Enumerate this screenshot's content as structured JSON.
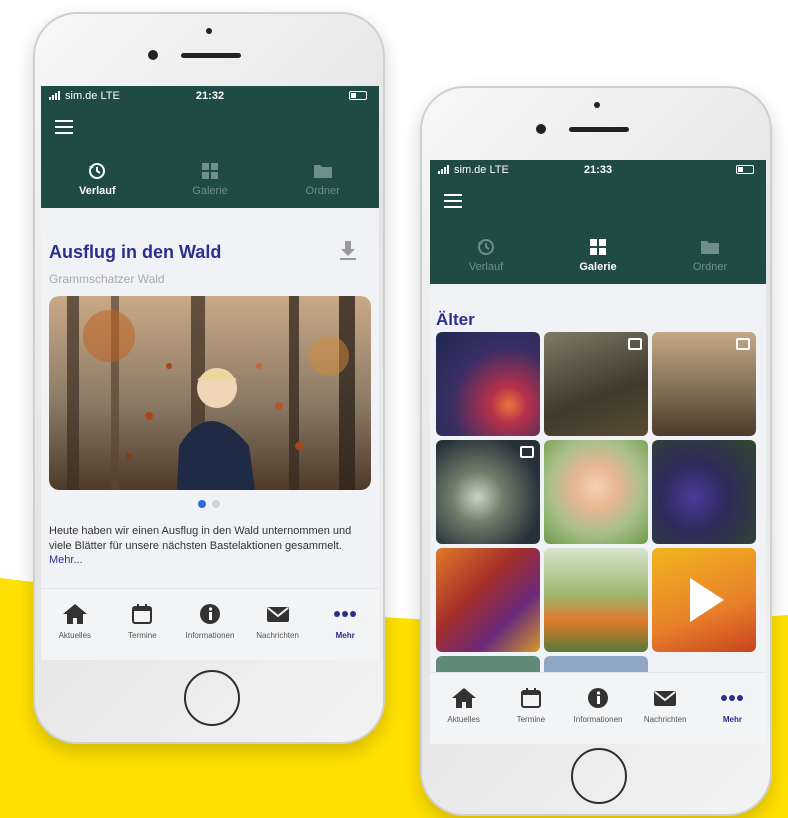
{
  "colors": {
    "accent": "#1f4a46",
    "brand": "#2b2f8e",
    "yellow": "#ffe100"
  },
  "phone1": {
    "status": {
      "carrier": "sim.de  LTE",
      "time": "21:32"
    },
    "tabs": [
      {
        "label": "Verlauf",
        "icon": "history-icon",
        "active": true
      },
      {
        "label": "Galerie",
        "icon": "grid-icon"
      },
      {
        "label": "Ordner",
        "icon": "folder-icon"
      }
    ],
    "post": {
      "title": "Ausflug in den Wald",
      "location": "Grammschatzer Wald",
      "description": "Heute haben wir einen Ausflug in den Wald unternommen und viele Blätter für unsere nächsten Bastelaktionen gesammelt.",
      "more": "Mehr...",
      "image_icon": "photo",
      "download_icon": "download-icon",
      "carousel": {
        "count": 2,
        "active": 1
      }
    },
    "nav": [
      {
        "label": "Aktuelles",
        "icon": "home-icon"
      },
      {
        "label": "Termine",
        "icon": "calendar-icon"
      },
      {
        "label": "Informationen",
        "icon": "info-icon"
      },
      {
        "label": "Nachrichten",
        "icon": "mail-icon"
      },
      {
        "label": "Mehr",
        "icon": "more-icon",
        "active": true
      }
    ]
  },
  "phone2": {
    "status": {
      "carrier": "sim.de  LTE",
      "time": "21:33"
    },
    "tabs": [
      {
        "label": "Verlauf",
        "icon": "history-icon"
      },
      {
        "label": "Galerie",
        "icon": "grid-icon",
        "active": true
      },
      {
        "label": "Ordner",
        "icon": "folder-icon"
      }
    ],
    "section": "Älter",
    "gallery": [
      {
        "color": "#3d2a5a",
        "badge": false
      },
      {
        "color": "#4f4a3a",
        "badge": true
      },
      {
        "color": "#6b5a3e",
        "badge": true
      },
      {
        "color": "#3e4a50",
        "badge": true
      },
      {
        "color": "#b5c7a0",
        "badge": false
      },
      {
        "color": "#4a3f6a",
        "badge": false
      },
      {
        "color": "#a4412f",
        "badge": false
      },
      {
        "color": "#7a9a5a",
        "badge": false
      },
      {
        "color": "#e59b2a",
        "badge": false,
        "video": true
      }
    ],
    "nav": [
      {
        "label": "Aktuelles",
        "icon": "home-icon"
      },
      {
        "label": "Termine",
        "icon": "calendar-icon"
      },
      {
        "label": "Informationen",
        "icon": "info-icon"
      },
      {
        "label": "Nachrichten",
        "icon": "mail-icon"
      },
      {
        "label": "Mehr",
        "icon": "more-icon",
        "active": true
      }
    ]
  }
}
